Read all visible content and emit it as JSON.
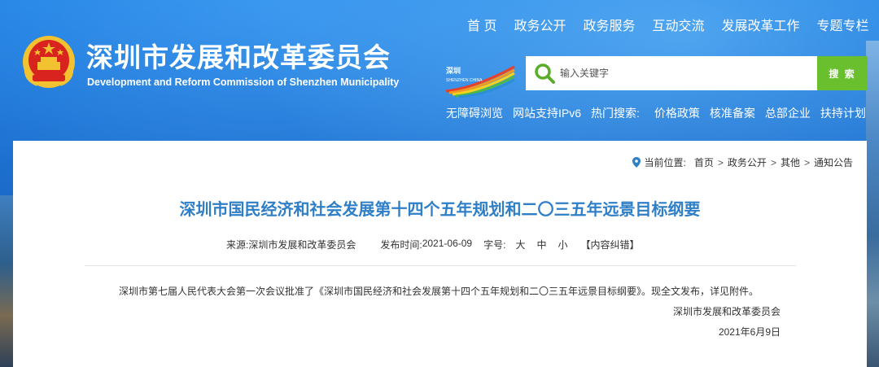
{
  "site": {
    "name_cn": "深圳市发展和改革委员会",
    "name_en": "Development and Reform Commission of Shenzhen Municipality",
    "city_logo_text": "SHENZHEN CHINA"
  },
  "top_nav": [
    "首 页",
    "政务公开",
    "政务服务",
    "互动交流",
    "发展改革工作",
    "专题专栏"
  ],
  "search": {
    "placeholder": "输入关键字",
    "button_label": "搜 索"
  },
  "quick_links": {
    "accessibility": "无障碍浏览",
    "ipv6": "网站支持IPv6",
    "hot_label": "热门搜索:",
    "hot_terms": [
      "价格政策",
      "核准备案",
      "总部企业",
      "扶持计划"
    ]
  },
  "breadcrumb": {
    "label": "当前位置:",
    "items": [
      "首页",
      "政务公开",
      "其他",
      "通知公告"
    ]
  },
  "article": {
    "title": "深圳市国民经济和社会发展第十四个五年规划和二〇三五年远景目标纲要",
    "source_label": "来源:",
    "source": "深圳市发展和改革委员会",
    "date_label": "发布时间:",
    "date": "2021-06-09",
    "font_size_label": "字号:",
    "size_large": "大",
    "size_medium": "中",
    "size_small": "小",
    "correction": "【内容纠错】",
    "body": "深圳市第七届人民代表大会第一次会议批准了《深圳市国民经济和社会发展第十四个五年规划和二〇三五年远景目标纲要》。现全文发布，详见附件。",
    "sign_org": "深圳市发展和改革委员会",
    "sign_date": "2021年6月9日"
  },
  "colors": {
    "header_blue": "#1b7be0",
    "title_blue": "#2f7fc8",
    "search_green": "#6abf2e"
  }
}
